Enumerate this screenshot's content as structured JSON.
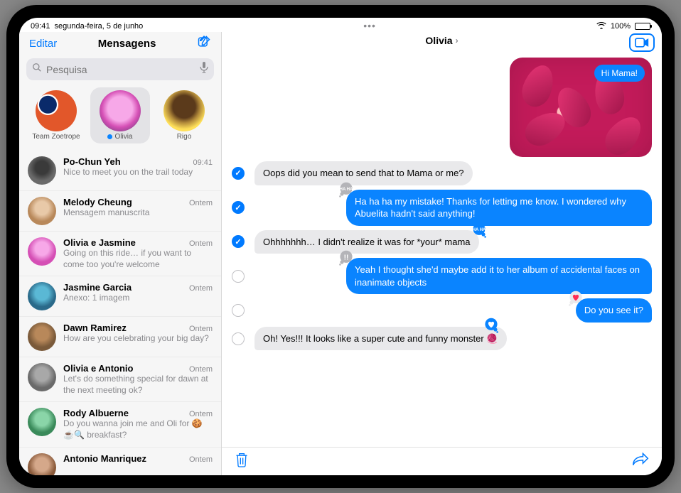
{
  "status": {
    "time": "09:41",
    "date": "segunda-feira, 5 de junho",
    "battery": "100%"
  },
  "sidebar": {
    "edit": "Editar",
    "title": "Mensagens",
    "search_placeholder": "Pesquisa",
    "pinned": [
      {
        "label": "Team Zoetrope",
        "unread": false
      },
      {
        "label": "Olivia",
        "unread": true
      },
      {
        "label": "Rigo",
        "unread": false
      }
    ],
    "conversations": [
      {
        "name": "Po-Chun Yeh",
        "time": "09:41",
        "preview": "Nice to meet you on the trail today",
        "avatar": "avatar-po"
      },
      {
        "name": "Melody Cheung",
        "time": "Ontem",
        "preview": "Mensagem manuscrita",
        "avatar": "avatar-mel"
      },
      {
        "name": "Olivia e Jasmine",
        "time": "Ontem",
        "preview": "Going on this ride… if you want to come too you're welcome",
        "avatar": "avatar-oj"
      },
      {
        "name": "Jasmine Garcia",
        "time": "Ontem",
        "preview": "Anexo: 1 imagem",
        "avatar": "avatar-jas"
      },
      {
        "name": "Dawn Ramirez",
        "time": "Ontem",
        "preview": "How are you celebrating your big day?",
        "avatar": "avatar-dawn"
      },
      {
        "name": "Olivia e Antonio",
        "time": "Ontem",
        "preview": "Let's do something special for dawn at the next meeting ok?",
        "avatar": "avatar-oa"
      },
      {
        "name": "Rody Albuerne",
        "time": "Ontem",
        "preview": "Do you wanna join me and Oli for 🍪☕🔍 breakfast?",
        "avatar": "avatar-rody"
      },
      {
        "name": "Antonio Manriquez",
        "time": "Ontem",
        "preview": "",
        "avatar": "avatar-ant"
      }
    ]
  },
  "chat": {
    "contact": "Olivia",
    "photo_caption": "Hi Mama!",
    "messages": [
      {
        "side": "in",
        "selected": true,
        "text": "Oops did you mean to send that to Mama or me?",
        "tapback": null
      },
      {
        "side": "out",
        "selected": true,
        "text": "Ha ha ha my mistake! Thanks for letting me know. I wondered why Abuelita hadn't said anything!",
        "tapback": "haha-grey"
      },
      {
        "side": "in",
        "selected": true,
        "text": "Ohhhhhhh… I didn't realize it was for *your* mama",
        "tapback": "haha-blue"
      },
      {
        "side": "out",
        "selected": false,
        "text": "Yeah I thought she'd maybe add it to her album of accidental faces on inanimate objects",
        "tapback": "exclaim-grey"
      },
      {
        "side": "out",
        "selected": false,
        "text": "Do you see it?",
        "tapback": "heart-pink"
      },
      {
        "side": "in",
        "selected": false,
        "text": "Oh! Yes!!! It looks like a super cute and funny monster 🧶",
        "tapback": "like-blue"
      }
    ]
  }
}
